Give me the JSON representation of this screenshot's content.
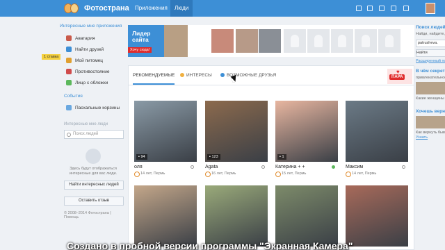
{
  "topbar": {
    "logo_text": "Фотострана",
    "nav": [
      "Приложения",
      "Люди"
    ]
  },
  "sidebar": {
    "apps_head": "Интересные мне приложения",
    "apps": [
      {
        "label": "Аватария",
        "color": "#c95a4a"
      },
      {
        "label": "Найти друзей",
        "color": "#3d8fd6"
      },
      {
        "label": "Мой питомец",
        "color": "#e0a030"
      },
      {
        "label": "Противостояние",
        "color": "#d04b4b"
      },
      {
        "label": "Лицо с обложки",
        "color": "#5cb85c"
      }
    ],
    "events_head": "События",
    "events": [
      {
        "label": "Пасхальные корзины",
        "color": "#6aa8e0"
      }
    ],
    "people_head": "Интересные мне люди",
    "search_placeholder": "Поиск людей",
    "people_note": "Здесь будут отображаться интересные для вас люди.",
    "find_button": "Найти интересных людей",
    "review_button": "Оставить отзыв",
    "copyright": "© 2008–2014 Фотострана | Помощь"
  },
  "leaders": {
    "badge": "Лидер сайта",
    "want": "Хочу сюда!",
    "place": "1 ставка"
  },
  "tabs": {
    "recommended": "РЕКОМЕНДУЕМЫЕ",
    "interests": "ИНТЕРЕСЫ",
    "possible": "ВОЗМОЖНЫЕ ДРУЗЬЯ",
    "para": "ПАРА"
  },
  "cards": [
    {
      "name": "оля",
      "photos": "94",
      "info": "14 лет, Пермь",
      "online": false,
      "color": "#8a9aa6"
    },
    {
      "name": "Agata",
      "photos": "123",
      "info": "16 лет, Пермь",
      "online": false,
      "color": "#8c6a4d"
    },
    {
      "name": "Катерина + +",
      "photos": "1",
      "info": "15 лет, Пермь",
      "online": true,
      "color": "#e8b6a0"
    },
    {
      "name": "Максим",
      "photos": "",
      "info": "14 лет, Пермь",
      "online": false,
      "color": "#6b7a86"
    },
    {
      "name": "",
      "photos": "",
      "info": "",
      "online": false,
      "color": "#c4a78a"
    },
    {
      "name": "",
      "photos": "",
      "info": "",
      "online": false,
      "color": "#9aaa7a"
    },
    {
      "name": "",
      "photos": "",
      "info": "",
      "online": false,
      "color": "#7d8b6a"
    },
    {
      "name": "",
      "photos": "",
      "info": "",
      "online": false,
      "color": "#a86a5a"
    }
  ],
  "rightcol": {
    "search_head": "Поиск людей",
    "search_text": "Найди, найдите, найди друзей, коллег",
    "search_value": "patrusheva.",
    "search_button": "Найти",
    "extended_link": "Расширенный поиск",
    "secret_head": "В чём секрет",
    "secret_text": "привлекательности",
    "secret_text2": "Какие женщины нравятся мужчинам",
    "want_head": "Хочешь вернуть",
    "want_text": "Как вернуть бывшую, используя психологию",
    "want_link": "Узнать"
  },
  "watermark": "Создано в пробной версии программы \"Экранная Камера\""
}
